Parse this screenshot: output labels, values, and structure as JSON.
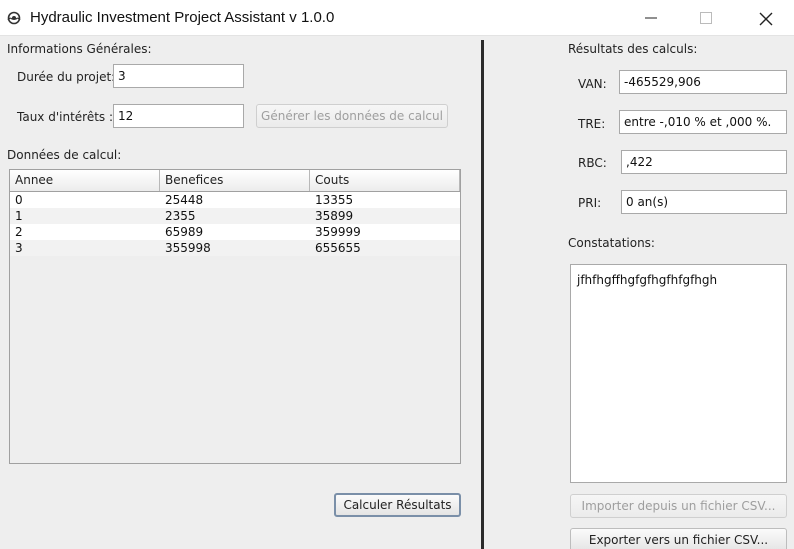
{
  "window": {
    "title": "Hydraulic Investment Project Assistant v 1.0.0",
    "app_icon": "gear-cloud-icon",
    "controls": [
      "minimize-icon",
      "maximize-icon",
      "close-icon"
    ]
  },
  "left": {
    "section_general": "Informations Générales:",
    "duree_label": "Durée du projet:",
    "duree_value": "3",
    "taux_label": "Taux d'intérêts :",
    "taux_value": "12",
    "generate_button": "Générer les données de calcul",
    "section_data": "Données de calcul:",
    "table": {
      "columns": [
        "Annee",
        "Benefices",
        "Couts"
      ],
      "rows": [
        [
          "0",
          "25448",
          "13355"
        ],
        [
          "1",
          "2355",
          "35899"
        ],
        [
          "2",
          "65989",
          "359999"
        ],
        [
          "3",
          "355998",
          "655655"
        ]
      ]
    },
    "calc_button": "Calculer Résultats"
  },
  "right": {
    "section_results": "Résultats des calculs:",
    "van_label": "VAN:",
    "van_value": "-465529,906",
    "tre_label": "TRE:",
    "tre_value": "entre -,010 % et ,000 %.",
    "rbc_label": "RBC:",
    "rbc_value": ",422",
    "pri_label": "PRI:",
    "pri_value": "0 an(s)",
    "constatations_label": "Constatations:",
    "constatations_text": "jfhfhgffhgfgfhgfhfgfhgh",
    "import_button": "Importer depuis un fichier CSV...",
    "export_button": "Exporter vers un fichier CSV..."
  },
  "colors": {
    "window_bg": "#eeeeee",
    "titlebar_bg": "#ffffff",
    "splitter": "#2a2a2a",
    "disabled_text": "#9e9e9e"
  }
}
